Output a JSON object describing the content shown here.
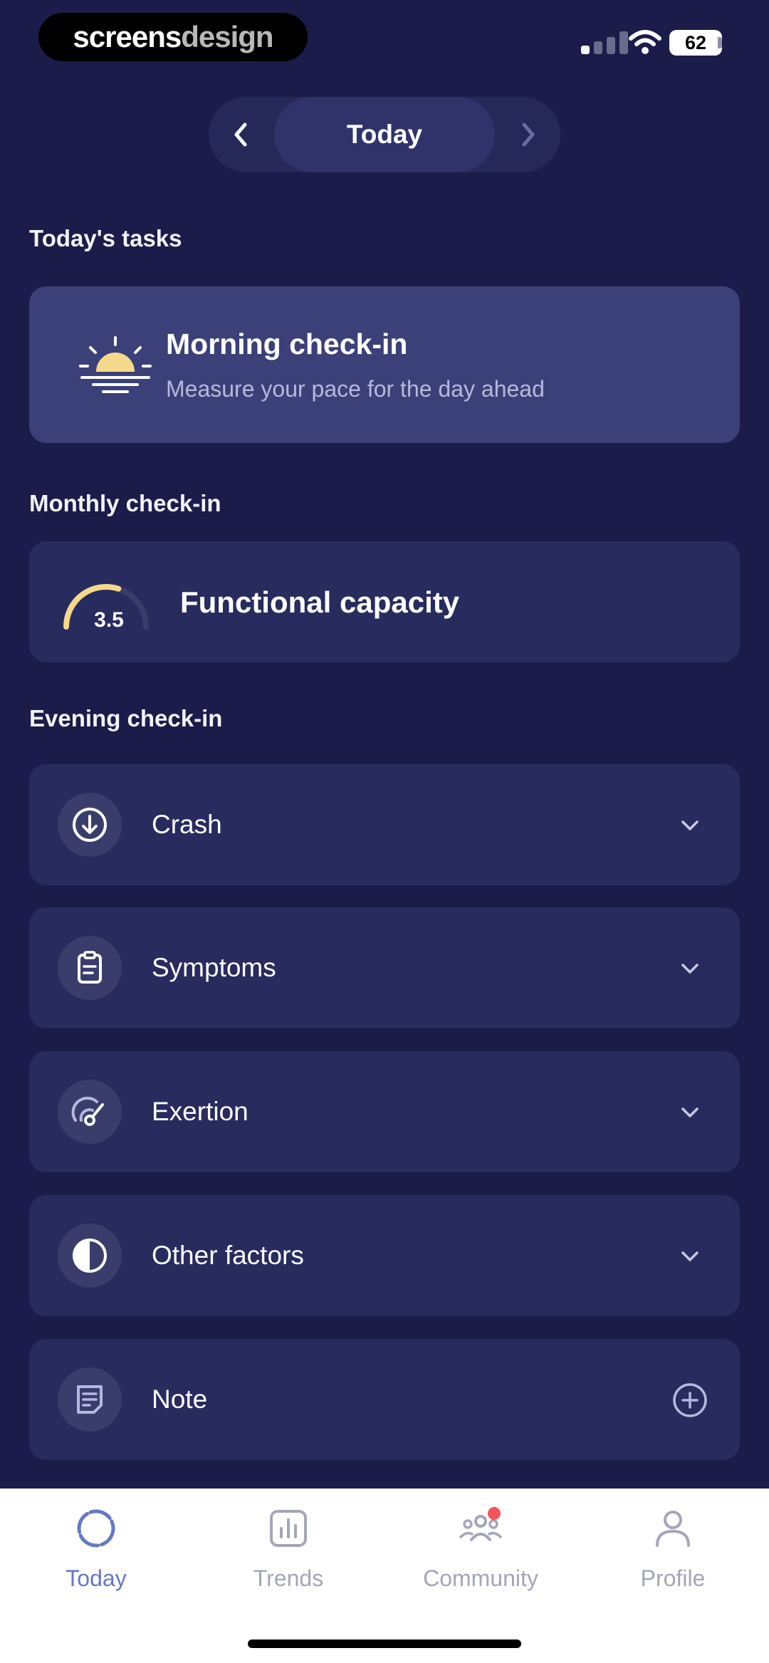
{
  "status_bar": {
    "brand_part1": "screens",
    "brand_part2": "design",
    "battery": "62"
  },
  "date_nav": {
    "label": "Today"
  },
  "sections": {
    "tasks_title": "Today's tasks",
    "monthly_title": "Monthly check-in",
    "evening_title": "Evening check-in"
  },
  "morning_card": {
    "title": "Morning check-in",
    "subtitle": "Measure your pace for the day ahead",
    "icon": "sunrise-icon"
  },
  "functional_card": {
    "gauge_value": "3.5",
    "gauge_fraction": 0.6,
    "label": "Functional capacity"
  },
  "evening_items": [
    {
      "label": "Crash",
      "icon": "arrow-down-circle-icon"
    },
    {
      "label": "Symptoms",
      "icon": "clipboard-icon"
    },
    {
      "label": "Exertion",
      "icon": "speedometer-icon"
    },
    {
      "label": "Other factors",
      "icon": "half-circle-icon"
    },
    {
      "label": "Note",
      "icon": "note-icon"
    }
  ],
  "tabs": [
    {
      "label": "Today",
      "icon": "today-ring-icon",
      "active": true
    },
    {
      "label": "Trends",
      "icon": "bar-chart-icon",
      "active": false
    },
    {
      "label": "Community",
      "icon": "people-icon",
      "active": false,
      "badge": true
    },
    {
      "label": "Profile",
      "icon": "person-icon",
      "active": false
    }
  ],
  "colors": {
    "background": "#1b1c4a",
    "card": "#282b5e",
    "highlight_card": "#3c4078",
    "accent_sun": "#f5d98a",
    "tab_active": "#6578c6",
    "tab_inactive": "#a4a6b8",
    "badge": "#f2545b"
  }
}
